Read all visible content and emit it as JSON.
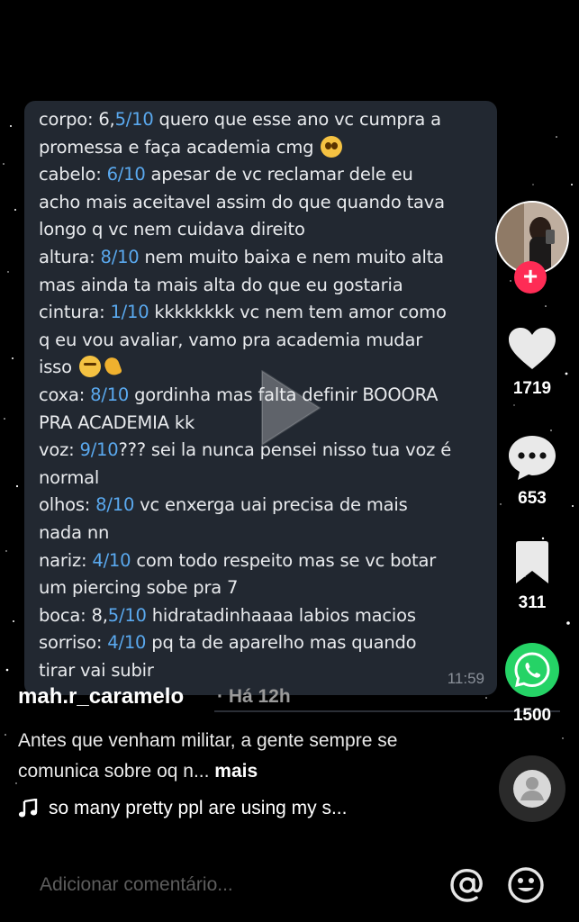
{
  "message": {
    "lines": [
      {
        "segments": [
          {
            "t": "corpo: 6,"
          },
          {
            "t": "5/10",
            "s": 1
          },
          {
            "t": " quero que esse ano vc cumpra a"
          }
        ]
      },
      {
        "segments": [
          {
            "t": "promessa e faça academia cmg "
          }
        ],
        "emoji": "plead"
      },
      {
        "segments": [
          {
            "t": "cabelo: "
          },
          {
            "t": "6/10",
            "s": 1
          },
          {
            "t": " apesar de vc reclamar dele eu"
          }
        ]
      },
      {
        "segments": [
          {
            "t": "acho mais aceitavel assim do que quando tava"
          }
        ]
      },
      {
        "segments": [
          {
            "t": "longo q vc nem cuidava direito"
          }
        ]
      },
      {
        "segments": [
          {
            "t": "altura: "
          },
          {
            "t": "8/10",
            "s": 1
          },
          {
            "t": " nem muito baixa e nem muito alta"
          }
        ]
      },
      {
        "segments": [
          {
            "t": "mas ainda ta mais alta do que eu gostaria"
          }
        ]
      },
      {
        "segments": [
          {
            "t": "cintura: "
          },
          {
            "t": "1/10",
            "s": 1
          },
          {
            "t": " kkkkkkkk vc nem tem amor como"
          }
        ]
      },
      {
        "segments": [
          {
            "t": "q eu vou avaliar, vamo pra academia mudar"
          }
        ]
      },
      {
        "segments": [
          {
            "t": "isso "
          }
        ],
        "emoji": "think-muscle"
      },
      {
        "segments": [
          {
            "t": "coxa: "
          },
          {
            "t": "8/10",
            "s": 1
          },
          {
            "t": " gordinha mas falta definir BOOORA"
          }
        ]
      },
      {
        "segments": [
          {
            "t": "PRA ACADEMIA kk"
          }
        ]
      },
      {
        "segments": [
          {
            "t": "voz: "
          },
          {
            "t": "9/10",
            "s": 1
          },
          {
            "t": "??? sei la nunca pensei nisso tua voz é"
          }
        ]
      },
      {
        "segments": [
          {
            "t": "normal"
          }
        ]
      },
      {
        "segments": [
          {
            "t": "olhos: "
          },
          {
            "t": "8/10",
            "s": 1
          },
          {
            "t": " vc enxerga uai precisa de mais"
          }
        ]
      },
      {
        "segments": [
          {
            "t": "nada nn"
          }
        ]
      },
      {
        "segments": [
          {
            "t": "nariz: "
          },
          {
            "t": "4/10",
            "s": 1
          },
          {
            "t": " com todo respeito mas se vc botar"
          }
        ]
      },
      {
        "segments": [
          {
            "t": "um piercing sobe pra 7"
          }
        ]
      },
      {
        "segments": [
          {
            "t": "boca: 8,"
          },
          {
            "t": "5/10",
            "s": 1
          },
          {
            "t": " hidratadinhaaaa labios macios"
          }
        ]
      },
      {
        "segments": [
          {
            "t": "sorriso: "
          },
          {
            "t": "4/10",
            "s": 1
          },
          {
            "t": " pq ta de aparelho mas quando"
          }
        ]
      },
      {
        "segments": [
          {
            "t": "tirar vai subir"
          }
        ]
      }
    ],
    "time": "11:59"
  },
  "sidebar": {
    "likes": "1719",
    "comments": "653",
    "saves": "311",
    "shares": "1500",
    "follow_symbol": "+"
  },
  "post": {
    "username": "mah.r_caramelo",
    "posted": "· Há 12h",
    "caption": "Antes que venham militar, a gente sempre se comunica sobre oq n... ",
    "more": "mais",
    "music": "so many pretty ppl are using my s..."
  },
  "comment_bar": {
    "placeholder": "Adicionar comentário..."
  },
  "colors": {
    "score": "#5aa9ef",
    "bubble": "#222831",
    "follow": "#fe2c55",
    "share": "#25d366"
  }
}
